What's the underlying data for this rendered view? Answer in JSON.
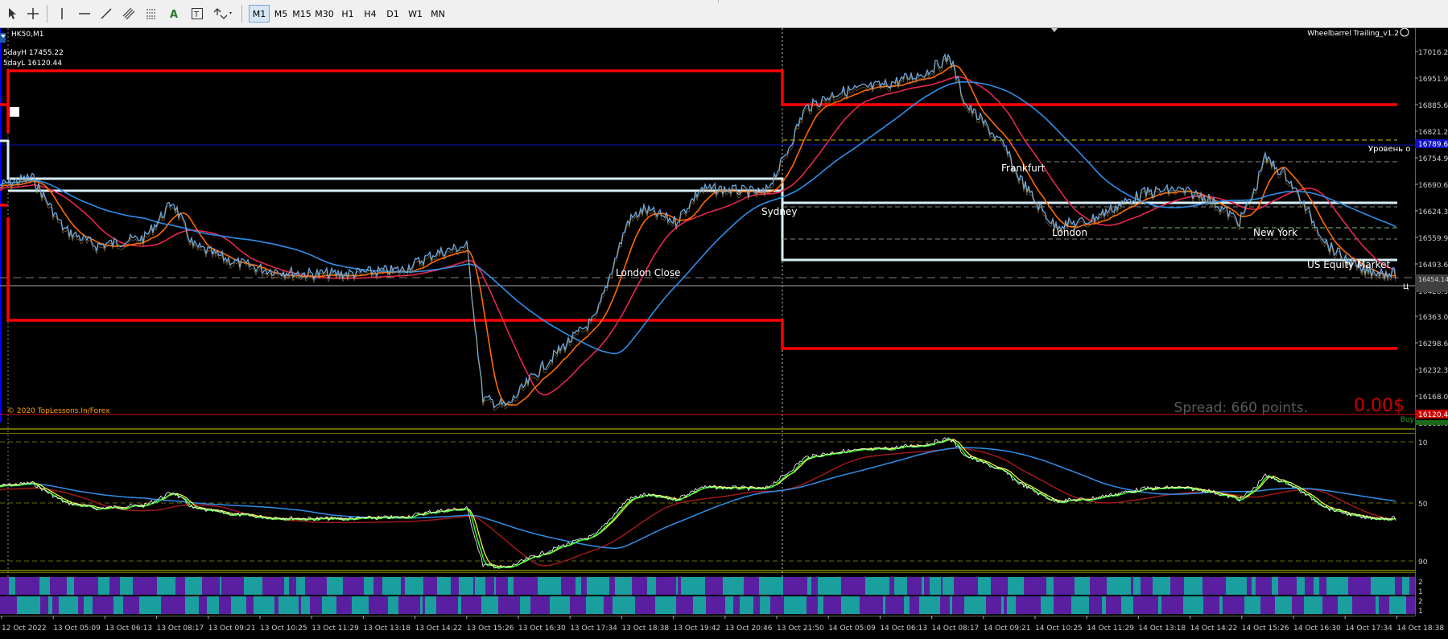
{
  "toolbar": {
    "tools": [
      {
        "name": "cursor-tool-icon"
      },
      {
        "name": "crosshair-tool-icon"
      },
      {
        "name": "vertical-line-tool-icon"
      },
      {
        "name": "horizontal-line-tool-icon"
      },
      {
        "name": "trendline-tool-icon"
      },
      {
        "name": "equidistant-channel-tool-icon"
      },
      {
        "name": "fibonacci-tool-icon"
      },
      {
        "name": "text-tool-icon"
      },
      {
        "name": "text-label-tool-icon"
      },
      {
        "name": "arrows-tool-icon"
      }
    ],
    "timeframes": [
      "M1",
      "M5",
      "M15",
      "M30",
      "H1",
      "H4",
      "D1",
      "W1",
      "MN"
    ],
    "active_timeframe": "M1"
  },
  "chart": {
    "symbol_header": "HK50,M1",
    "five_day_high": "5dayH 17455.22",
    "five_day_low": "5dayL 16120.44",
    "ea_label": "Wheelbarrel Trailing_v1.2",
    "copyright": "© 2020 TopLessons.In/Forex",
    "spread": "Spread: 660 points.",
    "profit": "0.00$",
    "buy_label": "Buy",
    "level_label": "Уровень о",
    "price_tag_label": "Ц",
    "sessions": [
      "Sydney",
      "London Close",
      "Frankfurt",
      "London",
      "New York",
      "US Equity Market"
    ],
    "price_axis": [
      "17016.25",
      "16951.90",
      "16885.60",
      "16821.25",
      "16754.95",
      "16690.60",
      "16624.30",
      "16559.95",
      "16493.65",
      "16428.30",
      "16363.00",
      "16298.65",
      "16232.35",
      "16168.00",
      "16103.65"
    ],
    "highlighted_prices": {
      "blue": "16789.66",
      "grey": "16454.14",
      "red": "16120.44"
    },
    "oscillator_axis": [
      "10",
      "50",
      "90"
    ],
    "bar_axis": [
      "2",
      "1",
      "2",
      "1"
    ],
    "time_axis": [
      "12 Oct 2022",
      "13 Oct 05:09",
      "13 Oct 06:13",
      "13 Oct 08:17",
      "13 Oct 09:21",
      "13 Oct 10:25",
      "13 Oct 11:29",
      "13 Oct 13:18",
      "13 Oct 14:22",
      "13 Oct 15:26",
      "13 Oct 16:30",
      "13 Oct 17:34",
      "13 Oct 18:38",
      "13 Oct 19:42",
      "13 Oct 20:46",
      "13 Oct 21:50",
      "14 Oct 05:09",
      "14 Oct 06:13",
      "14 Oct 08:17",
      "14 Oct 09:21",
      "14 Oct 10:25",
      "14 Oct 11:29",
      "14 Oct 13:18",
      "14 Oct 14:22",
      "14 Oct 15:26",
      "14 Oct 16:30",
      "14 Oct 17:34",
      "14 Oct 18:38"
    ],
    "colors": {
      "background": "#000000",
      "price_line": "#6fa8dc",
      "red_level": "#ff0000",
      "white_level": "#d9eef7",
      "orange_ma": "#ff6a00",
      "crimson_ma": "#e8264f",
      "blue_ma": "#2f8fe8",
      "osc_green": "#33ff33",
      "osc_yellow": "#ffff33",
      "bar_teal": "#1a9e9e",
      "bar_purple": "#5a1fa0"
    }
  }
}
